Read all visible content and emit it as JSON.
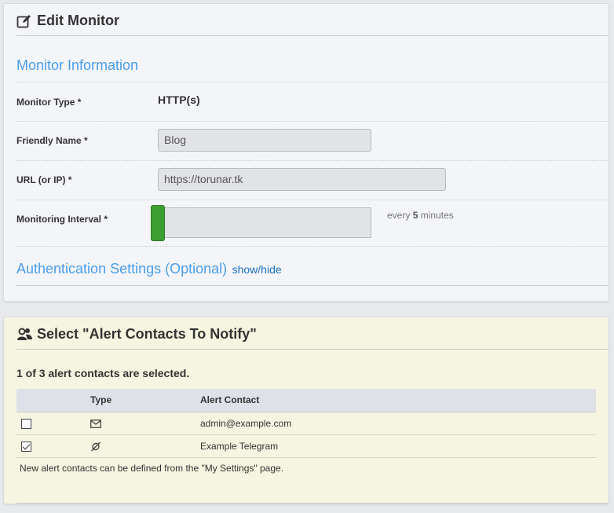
{
  "edit_panel": {
    "title": "Edit Monitor",
    "monitor_info_heading": "Monitor Information",
    "monitor_type": {
      "label": "Monitor Type *",
      "value": "HTTP(s)"
    },
    "friendly_name": {
      "label": "Friendly Name *",
      "value": "Blog"
    },
    "url": {
      "label": "URL (or IP) *",
      "value": "https://torunar.tk"
    },
    "interval": {
      "label": "Monitoring Interval *",
      "prefix": "every",
      "value": "5",
      "unit": "minutes",
      "slider_level": 0
    },
    "auth_heading": "Authentication Settings (Optional)",
    "auth_toggle": "show/hide"
  },
  "alert_panel": {
    "title": "Select \"Alert Contacts To Notify\"",
    "summary": "1 of 3 alert contacts are selected.",
    "columns": {
      "check": "",
      "type": "Type",
      "contact": "Alert Contact"
    },
    "rows": [
      {
        "checked": false,
        "type_icon": "envelope-icon",
        "contact": "admin@example.com"
      },
      {
        "checked": true,
        "type_icon": "telegram-icon",
        "contact": "Example Telegram"
      }
    ],
    "note": "New alert contacts can be defined from the \"My Settings\" page."
  },
  "colors": {
    "accent": "#4a9de8",
    "link": "#1a6ebf",
    "slider": "#3c9f32",
    "alert_bg": "#f5f5e1"
  }
}
